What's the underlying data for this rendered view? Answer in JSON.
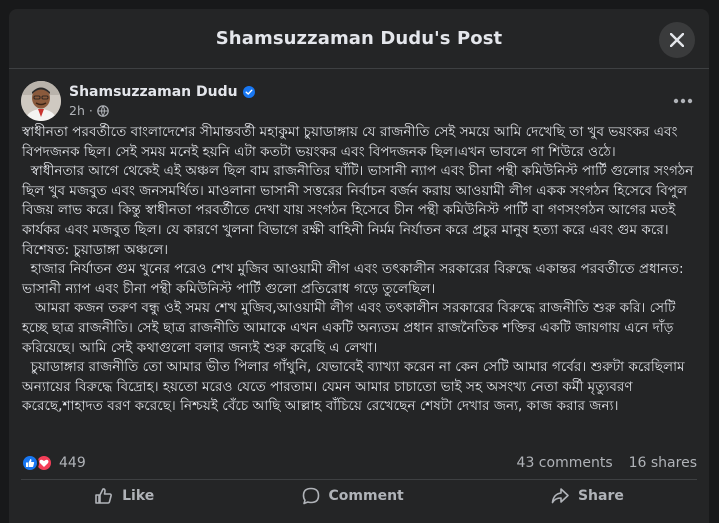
{
  "modal": {
    "title": "Shamsuzzaman Dudu's Post",
    "close_icon": "close-icon"
  },
  "post": {
    "author": "Shamsuzzaman Dudu",
    "verified_icon": "verified-badge-icon",
    "time": "2h",
    "privacy_icon": "globe-icon",
    "more_icon": "more-options-icon",
    "text": "স্বাধীনতা পরবর্তীতে বাংলাদেশের সীমান্তবর্তী মহাকুমা চুয়াডাঙ্গায় যে রাজনীতি সেই সময়ে আমি দেখেছি তা খুব ভয়ংকর এবং বিপদজনক ছিল। সেই সময় মনেই হয়নি এটা কতটা ভয়ংকর এবং বিপদজনক ছিল।এখন ভাবলে গা শিউরে ওঠে।\n  স্বাধীনতার আগে থেকেই এই অঞ্চল ছিল বাম রাজনীতির ঘাঁটি। ভাসানী ন্যাপ এবং চীনা পন্থী কমিউনিস্ট পার্টি গুলোর সংগঠন ছিল খুব মজবুত এবং জনসমর্থিত। মাওলানা ভাসানী সত্তরের নির্বাচন বর্জন করায় আওয়ামী লীগ একক সংগঠন হিসেবে বিপুল বিজয় লাভ করে। কিন্তু স্বাধীনতা পরবর্তীতে দেখা যায় সংগঠন হিসেবে চীন পন্থী কমিউনিস্ট পার্টি বা গণসংগঠন আগের মতই কার্যকর এবং মজবুত ছিল। যে কারণে খুলনা বিভাগে রক্ষী বাহিনী নির্মম নির্যাতন করে প্রচুর মানুষ হত্যা করে এবং গুম করে। বিশেষত: চুয়াডাঙ্গা অঞ্চলে।\n  হাজার নির্যাতন গুম খুনের পরেও শেখ মুজিব আওয়ামী লীগ এবং তৎকালীন সরকারের বিরুদ্ধে একান্তর পরবর্তীতে প্রধানত: ভাসানী ন্যাপ এবং চীনা পন্থী কমিউনিস্ট পার্টি গুলো প্রতিরোধ গড়ে তুলেছিল।\n   আমরা কজন তরুণ বন্ধু ওই সময় শেখ মুজিব,আওয়ামী লীগ এবং তৎকালীন সরকারের বিরুদ্ধে রাজনীতি শুরু করি। সেটি হচ্ছে ছাত্র রাজনীতি। সেই ছাত্র রাজনীতি আমাকে এখন একটি অন্যতম প্রধান রাজনৈতিক শক্তির একটি জায়গায় এনে দাঁড় করিয়েছে। আমি সেই কথাগুলো বলার জন্যই শুরু করেছি এ লেখা।\n  চুয়াডাঙ্গার রাজনীতি তো আমার ভীত পিলার গাঁথুনি, যেভাবেই ব্যাখ্যা করেন না কেন সেটি আমার গর্বের। শুরুটা করেছিলাম অন্যায়ের বিরুদ্ধে বিদ্রোহ। হয়তো মরেও যেতে পারতাম। যেমন আমার চাচাতো ভাই সহ অসংখ্য নেতা কর্মী মৃত্যুবরণ করেছে,শাহাদত বরণ করেছে। নিশ্চয়ই বেঁচে আছি আল্লাহ বাঁচিয়ে রেখেছেন শেষটা দেখার জন্য, কাজ করার জন্য।"
  },
  "engagement": {
    "reaction_icons": [
      "like-reaction-icon",
      "love-reaction-icon"
    ],
    "reaction_count": "449",
    "comments": "43 comments",
    "shares": "16 shares"
  },
  "actions": {
    "like": "Like",
    "comment": "Comment",
    "share": "Share"
  },
  "colors": {
    "background": "#18191a",
    "card": "#242526",
    "text": "#e4e6eb",
    "secondary_text": "#b0b3b8",
    "accent_blue": "#1877f2",
    "love_red": "#f33e58"
  }
}
